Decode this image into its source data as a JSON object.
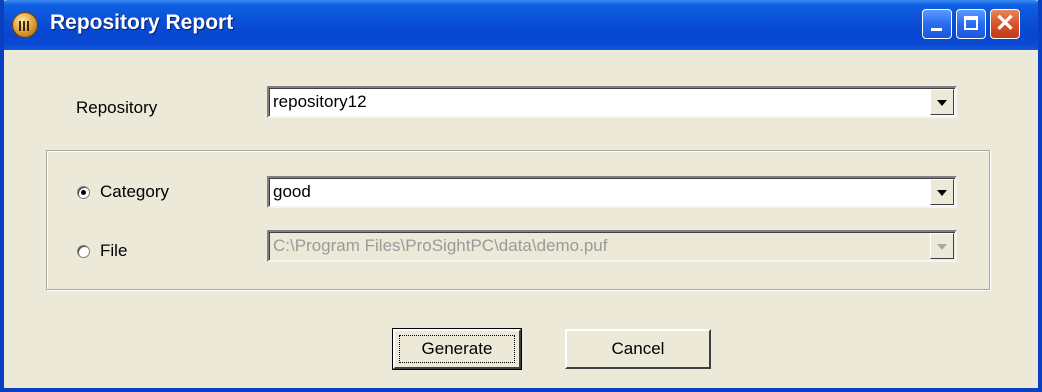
{
  "window": {
    "title": "Repository Report",
    "icon": "app-chart-icon",
    "controls": {
      "minimize": "minimize",
      "maximize": "maximize",
      "close": "close"
    }
  },
  "repository": {
    "label": "Repository",
    "value": "repository12"
  },
  "source": {
    "category": {
      "label": "Category",
      "selected": true,
      "value": "good"
    },
    "file": {
      "label": "File",
      "selected": false,
      "value": "C:\\Program Files\\ProSightPC\\data\\demo.puf",
      "disabled": true
    }
  },
  "buttons": {
    "generate": "Generate",
    "cancel": "Cancel"
  },
  "colors": {
    "titlebar": "#0a4fd6",
    "window_bg": "#ece9d8",
    "close_button": "#d8522a"
  }
}
